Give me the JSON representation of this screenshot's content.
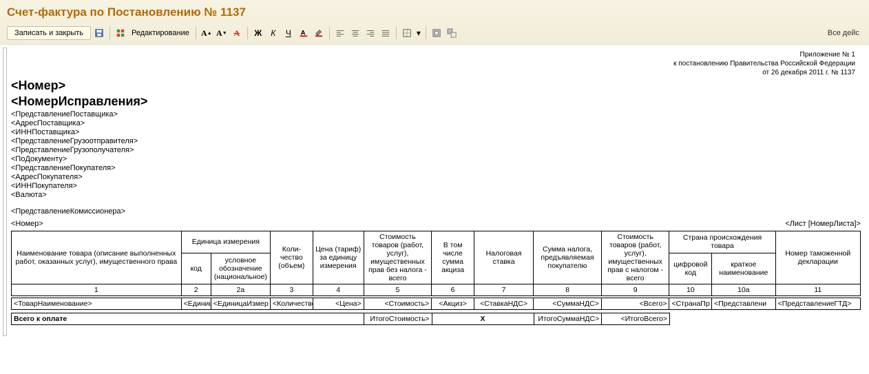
{
  "header": {
    "title": "Счет-фактура по Постановлению № 1137",
    "save_close": "Записать и закрыть",
    "edit": "Редактирование",
    "all_actions": "Все дейс"
  },
  "fmt": {
    "bold": "Ж",
    "italic": "К",
    "underline": "Ч"
  },
  "attachment": {
    "line1": "Приложение № 1",
    "line2": "к постановлению Правительства Российской Федерации",
    "line3": "от 26 декабря 2011 г. № 1137"
  },
  "fields": {
    "number": "<Номер>",
    "correction_number": "<НомерИсправления>",
    "supplier_repr": "<ПредставлениеПоставщика>",
    "supplier_addr": "<АдресПоставщика>",
    "supplier_inn": "<ИННПоставщика>",
    "shipper_repr": "<ПредставлениеГрузоотправителя>",
    "consignee_repr": "<ПредставлениеГрузополучателя>",
    "by_document": "<ПоДокументу>",
    "buyer_repr": "<ПредставлениеПокупателя>",
    "buyer_addr": "<АдресПокупателя>",
    "buyer_inn": "<ИННПокупателя>",
    "currency": "<Валюта>",
    "commissioner_repr": "<ПредставлениеКомиссионера>",
    "number2": "<Номер>",
    "sheet": "<Лист [НомерЛиста]>"
  },
  "cols": {
    "c1": "Наименование товара (описание выполненных работ, оказанных услуг), имущественного права",
    "c2group": "Единица измерения",
    "c2": "код",
    "c2a": "условное обозначение (национальное)",
    "c3": "Коли-чество (объем)",
    "c4": "Цена (тариф) за единицу измерения",
    "c5": "Стоимость товаров (работ, услуг), имущественных прав без налога - всего",
    "c6": "В том числе сумма акциза",
    "c7": "Налоговая ставка",
    "c8": "Сумма налога, предъявляемая покупателю",
    "c9": "Стоимость товаров (работ, услуг), имущественных прав с налогом - всего",
    "c10group": "Страна происхождения товара",
    "c10": "цифровой код",
    "c10a": "краткое наименование",
    "c11": "Номер таможенной декларации",
    "n1": "1",
    "n2": "2",
    "n2a": "2а",
    "n3": "3",
    "n4": "4",
    "n5": "5",
    "n6": "6",
    "n7": "7",
    "n8": "8",
    "n9": "9",
    "n10": "10",
    "n10a": "10а",
    "n11": "11"
  },
  "row": {
    "name": "<ТоварНаименование>",
    "unit_code": "<Единиц",
    "unit_name": "<ЕдиницаИзмер",
    "qty": "<Количество>",
    "price": "<Цена>",
    "cost": "<Стоимость>",
    "excise": "<Акциз>",
    "vat_rate": "<СтавкаНДС>",
    "vat_sum": "<СуммаНДС>",
    "total": "<Всего>",
    "country_code": "<СтранаПр",
    "country_name": "<Представлени",
    "gtd": "<ПредставлениеГТД>"
  },
  "totals": {
    "label": "Всего к оплате",
    "cost": "ИтогоСтоимость>",
    "excise_x": "X",
    "vat_sum": "ИтогоСуммаНДС>",
    "total": "<ИтогоВсего>"
  }
}
